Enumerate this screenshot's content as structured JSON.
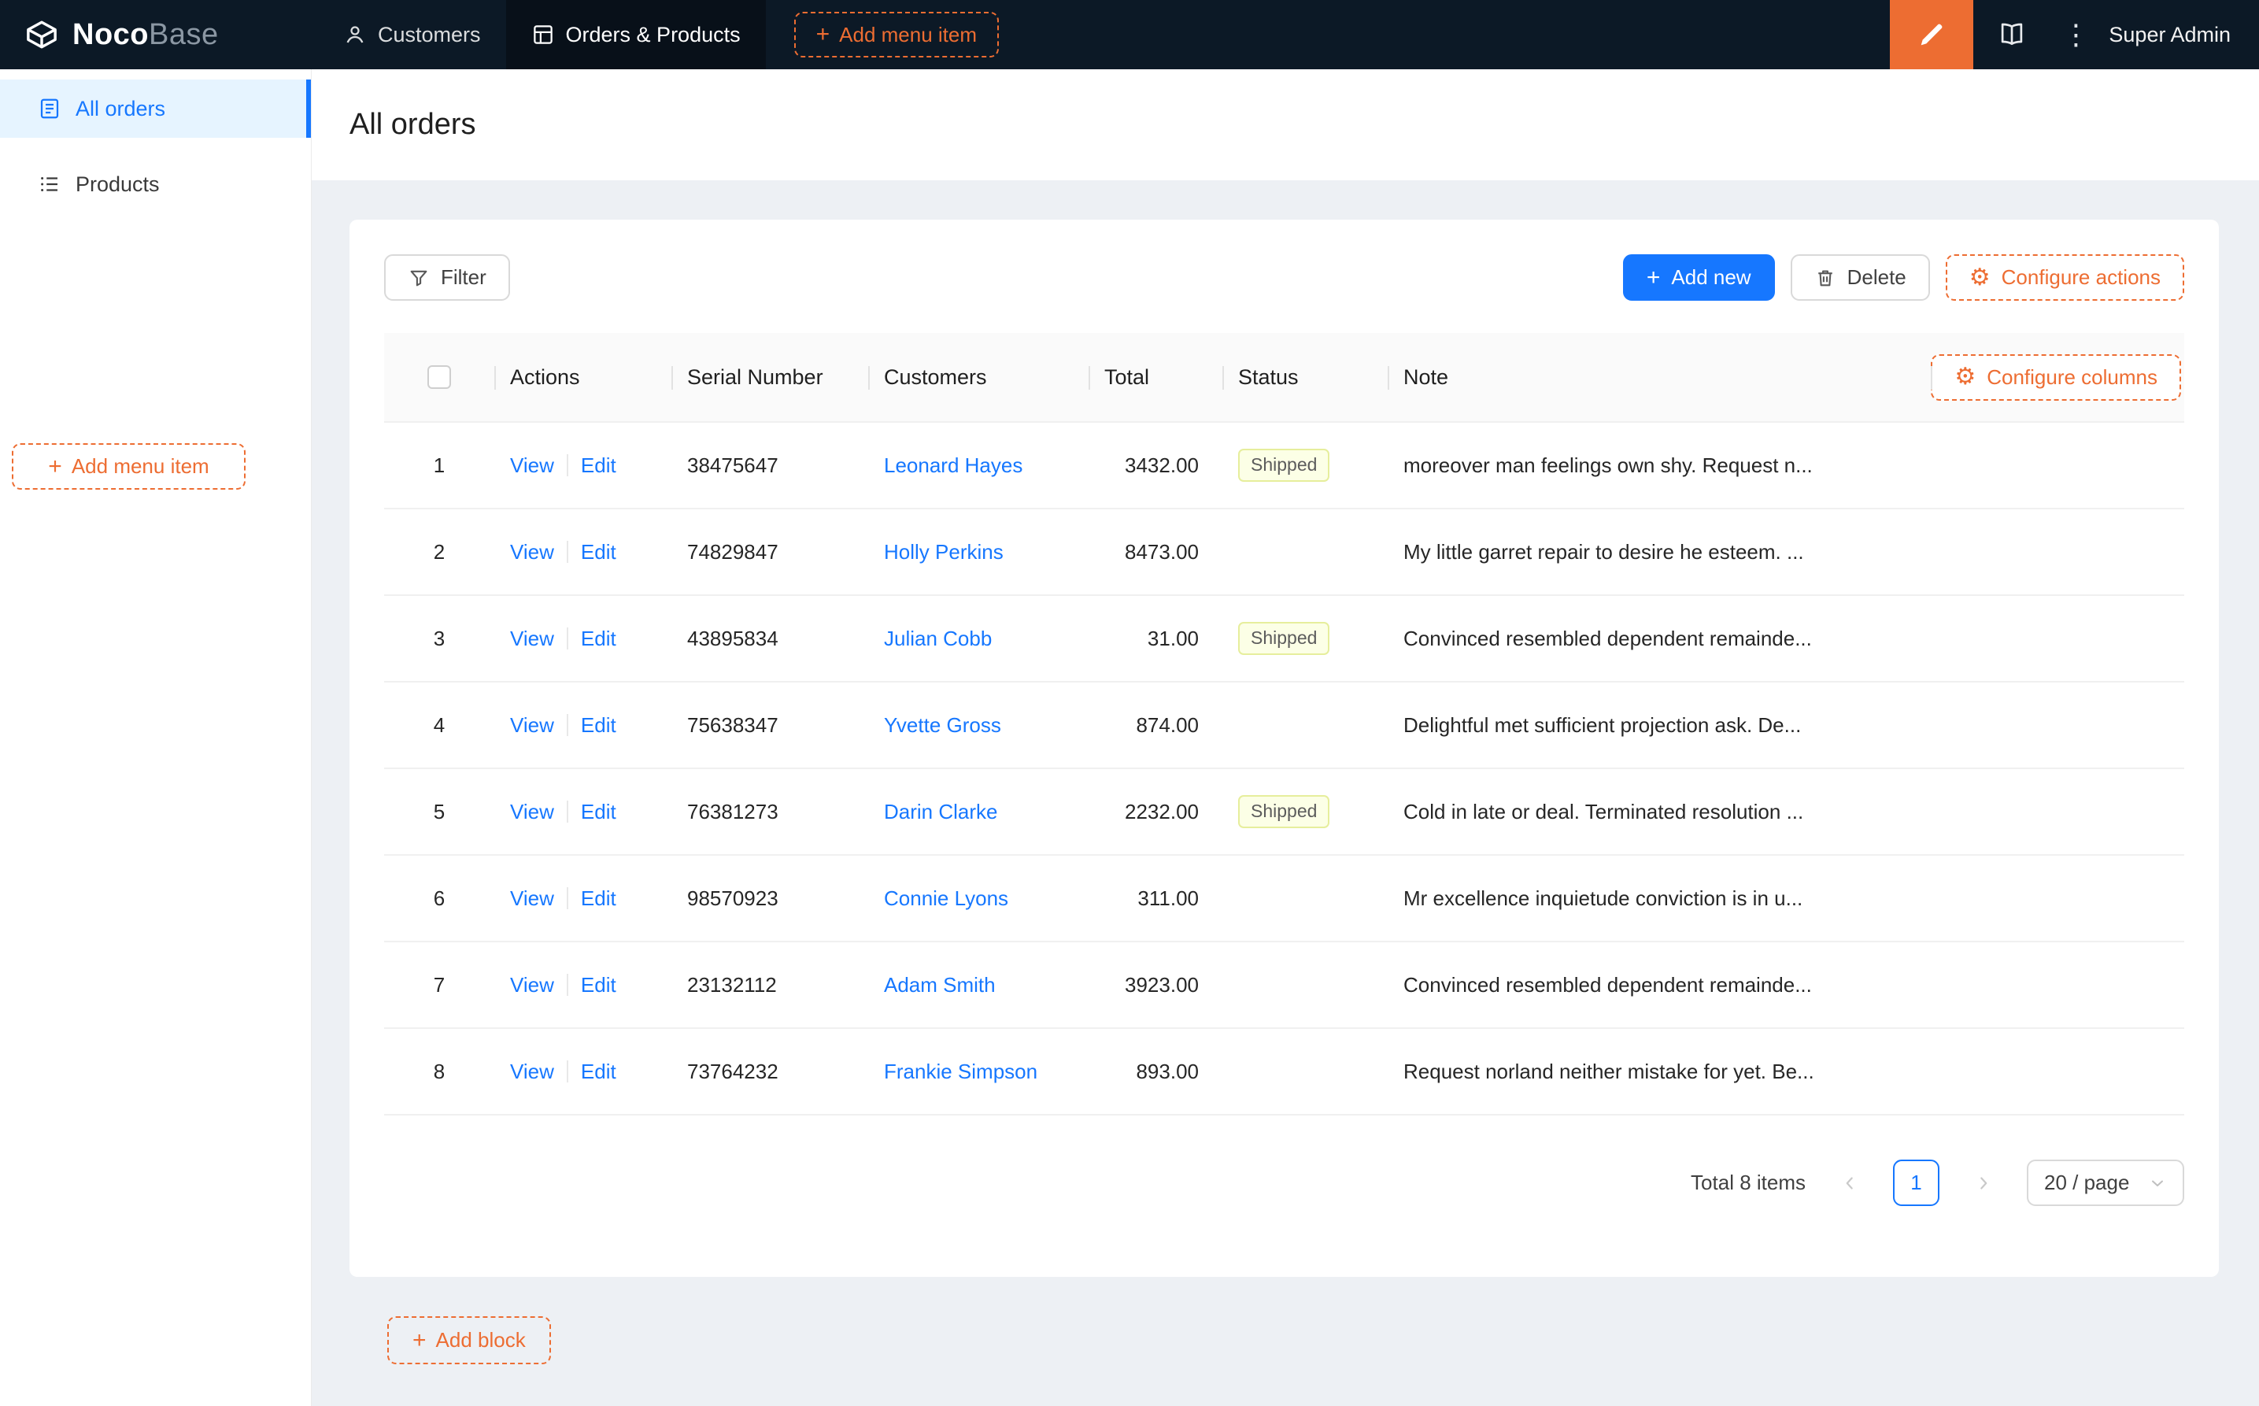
{
  "colors": {
    "primary": "#1677ff",
    "designer_orange": "#ed6d32",
    "nav_bg": "#0c1926",
    "status_tag_bg": "#fcffe6",
    "status_tag_border": "#e6ee9c"
  },
  "icons": {
    "plus": "+",
    "gear": "⚙",
    "ellipsis": "⋮"
  },
  "nav": {
    "logo_bold": "Noco",
    "logo_light": "Base",
    "items": [
      {
        "label": "Customers"
      },
      {
        "label": "Orders & Products"
      }
    ],
    "add_menu_item": "Add menu item",
    "user": "Super Admin"
  },
  "sidebar": {
    "items": [
      {
        "label": "All orders"
      },
      {
        "label": "Products"
      }
    ],
    "add_menu_item": "Add menu item"
  },
  "page": {
    "title": "All orders"
  },
  "toolbar": {
    "filter": "Filter",
    "add_new": "Add new",
    "delete": "Delete",
    "configure_actions": "Configure actions"
  },
  "table": {
    "headers": {
      "actions": "Actions",
      "serial": "Serial Number",
      "customers": "Customers",
      "total": "Total",
      "status": "Status",
      "note": "Note"
    },
    "configure_columns": "Configure columns",
    "row_actions": {
      "view": "View",
      "edit": "Edit"
    },
    "rows": [
      {
        "index": "1",
        "serial": "38475647",
        "customer": "Leonard Hayes",
        "total": "3432.00",
        "status": "Shipped",
        "note": "moreover man feelings own shy. Request n..."
      },
      {
        "index": "2",
        "serial": "74829847",
        "customer": "Holly Perkins",
        "total": "8473.00",
        "status": "",
        "note": "My little garret repair to desire he esteem. ..."
      },
      {
        "index": "3",
        "serial": "43895834",
        "customer": "Julian Cobb",
        "total": "31.00",
        "status": "Shipped",
        "note": "Convinced resembled dependent remainde..."
      },
      {
        "index": "4",
        "serial": "75638347",
        "customer": "Yvette Gross",
        "total": "874.00",
        "status": "",
        "note": "Delightful met sufficient projection ask. De..."
      },
      {
        "index": "5",
        "serial": "76381273",
        "customer": "Darin Clarke",
        "total": "2232.00",
        "status": "Shipped",
        "note": "Cold in late or deal. Terminated resolution ..."
      },
      {
        "index": "6",
        "serial": "98570923",
        "customer": "Connie Lyons",
        "total": "311.00",
        "status": "",
        "note": "Mr excellence inquietude conviction is in u..."
      },
      {
        "index": "7",
        "serial": "23132112",
        "customer": "Adam Smith",
        "total": "3923.00",
        "status": "",
        "note": "Convinced resembled dependent remainde..."
      },
      {
        "index": "8",
        "serial": "73764232",
        "customer": "Frankie Simpson",
        "total": "893.00",
        "status": "",
        "note": "Request norland neither mistake for yet. Be..."
      }
    ]
  },
  "pagination": {
    "total": "Total 8 items",
    "page": "1",
    "page_size": "20 / page"
  },
  "footer": {
    "add_block": "Add block"
  }
}
